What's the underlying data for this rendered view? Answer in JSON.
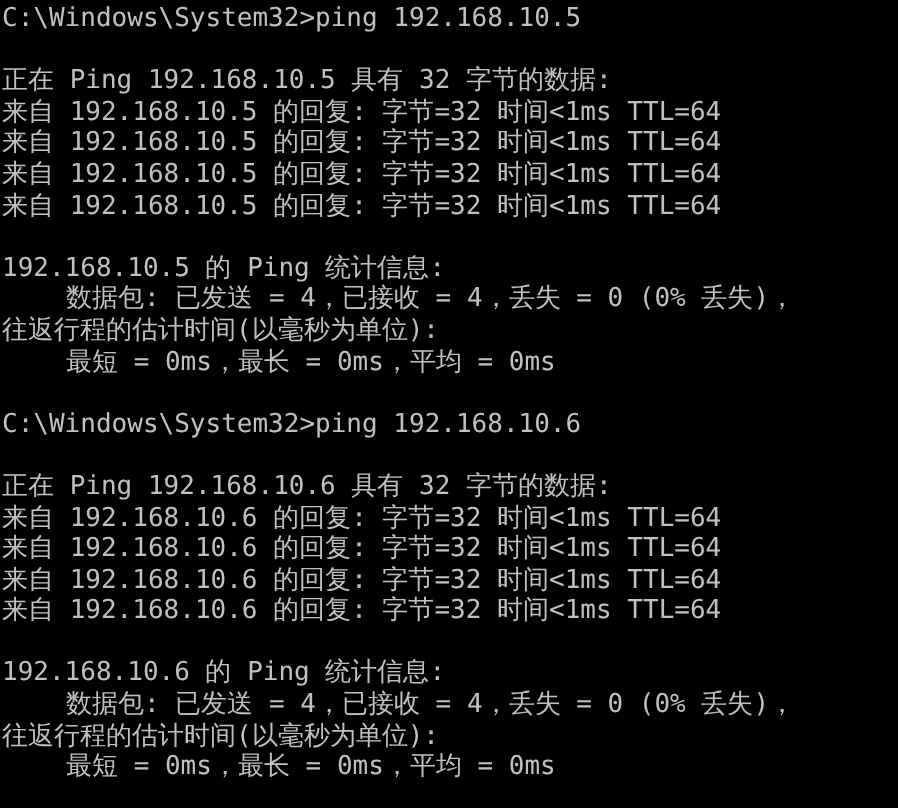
{
  "sessions": [
    {
      "command": "C:\\Windows\\System32>ping 192.168.10.5",
      "header": "正在 Ping 192.168.10.5 具有 32 字节的数据:",
      "replies": [
        "来自 192.168.10.5 的回复: 字节=32 时间<1ms TTL=64",
        "来自 192.168.10.5 的回复: 字节=32 时间<1ms TTL=64",
        "来自 192.168.10.5 的回复: 字节=32 时间<1ms TTL=64",
        "来自 192.168.10.5 的回复: 字节=32 时间<1ms TTL=64"
      ],
      "statistics_title": "192.168.10.5 的 Ping 统计信息:",
      "packets": "数据包: 已发送 = 4，已接收 = 4，丢失 = 0 (0% 丢失)，",
      "rtt_title": "往返行程的估计时间(以毫秒为单位):",
      "rtt": "最短 = 0ms，最长 = 0ms，平均 = 0ms"
    },
    {
      "command": "C:\\Windows\\System32>ping 192.168.10.6",
      "header": "正在 Ping 192.168.10.6 具有 32 字节的数据:",
      "replies": [
        "来自 192.168.10.6 的回复: 字节=32 时间<1ms TTL=64",
        "来自 192.168.10.6 的回复: 字节=32 时间<1ms TTL=64",
        "来自 192.168.10.6 的回复: 字节=32 时间<1ms TTL=64",
        "来自 192.168.10.6 的回复: 字节=32 时间<1ms TTL=64"
      ],
      "statistics_title": "192.168.10.6 的 Ping 统计信息:",
      "packets": "数据包: 已发送 = 4，已接收 = 4，丢失 = 0 (0% 丢失)，",
      "rtt_title": "往返行程的估计时间(以毫秒为单位):",
      "rtt": "最短 = 0ms，最长 = 0ms，平均 = 0ms"
    }
  ]
}
